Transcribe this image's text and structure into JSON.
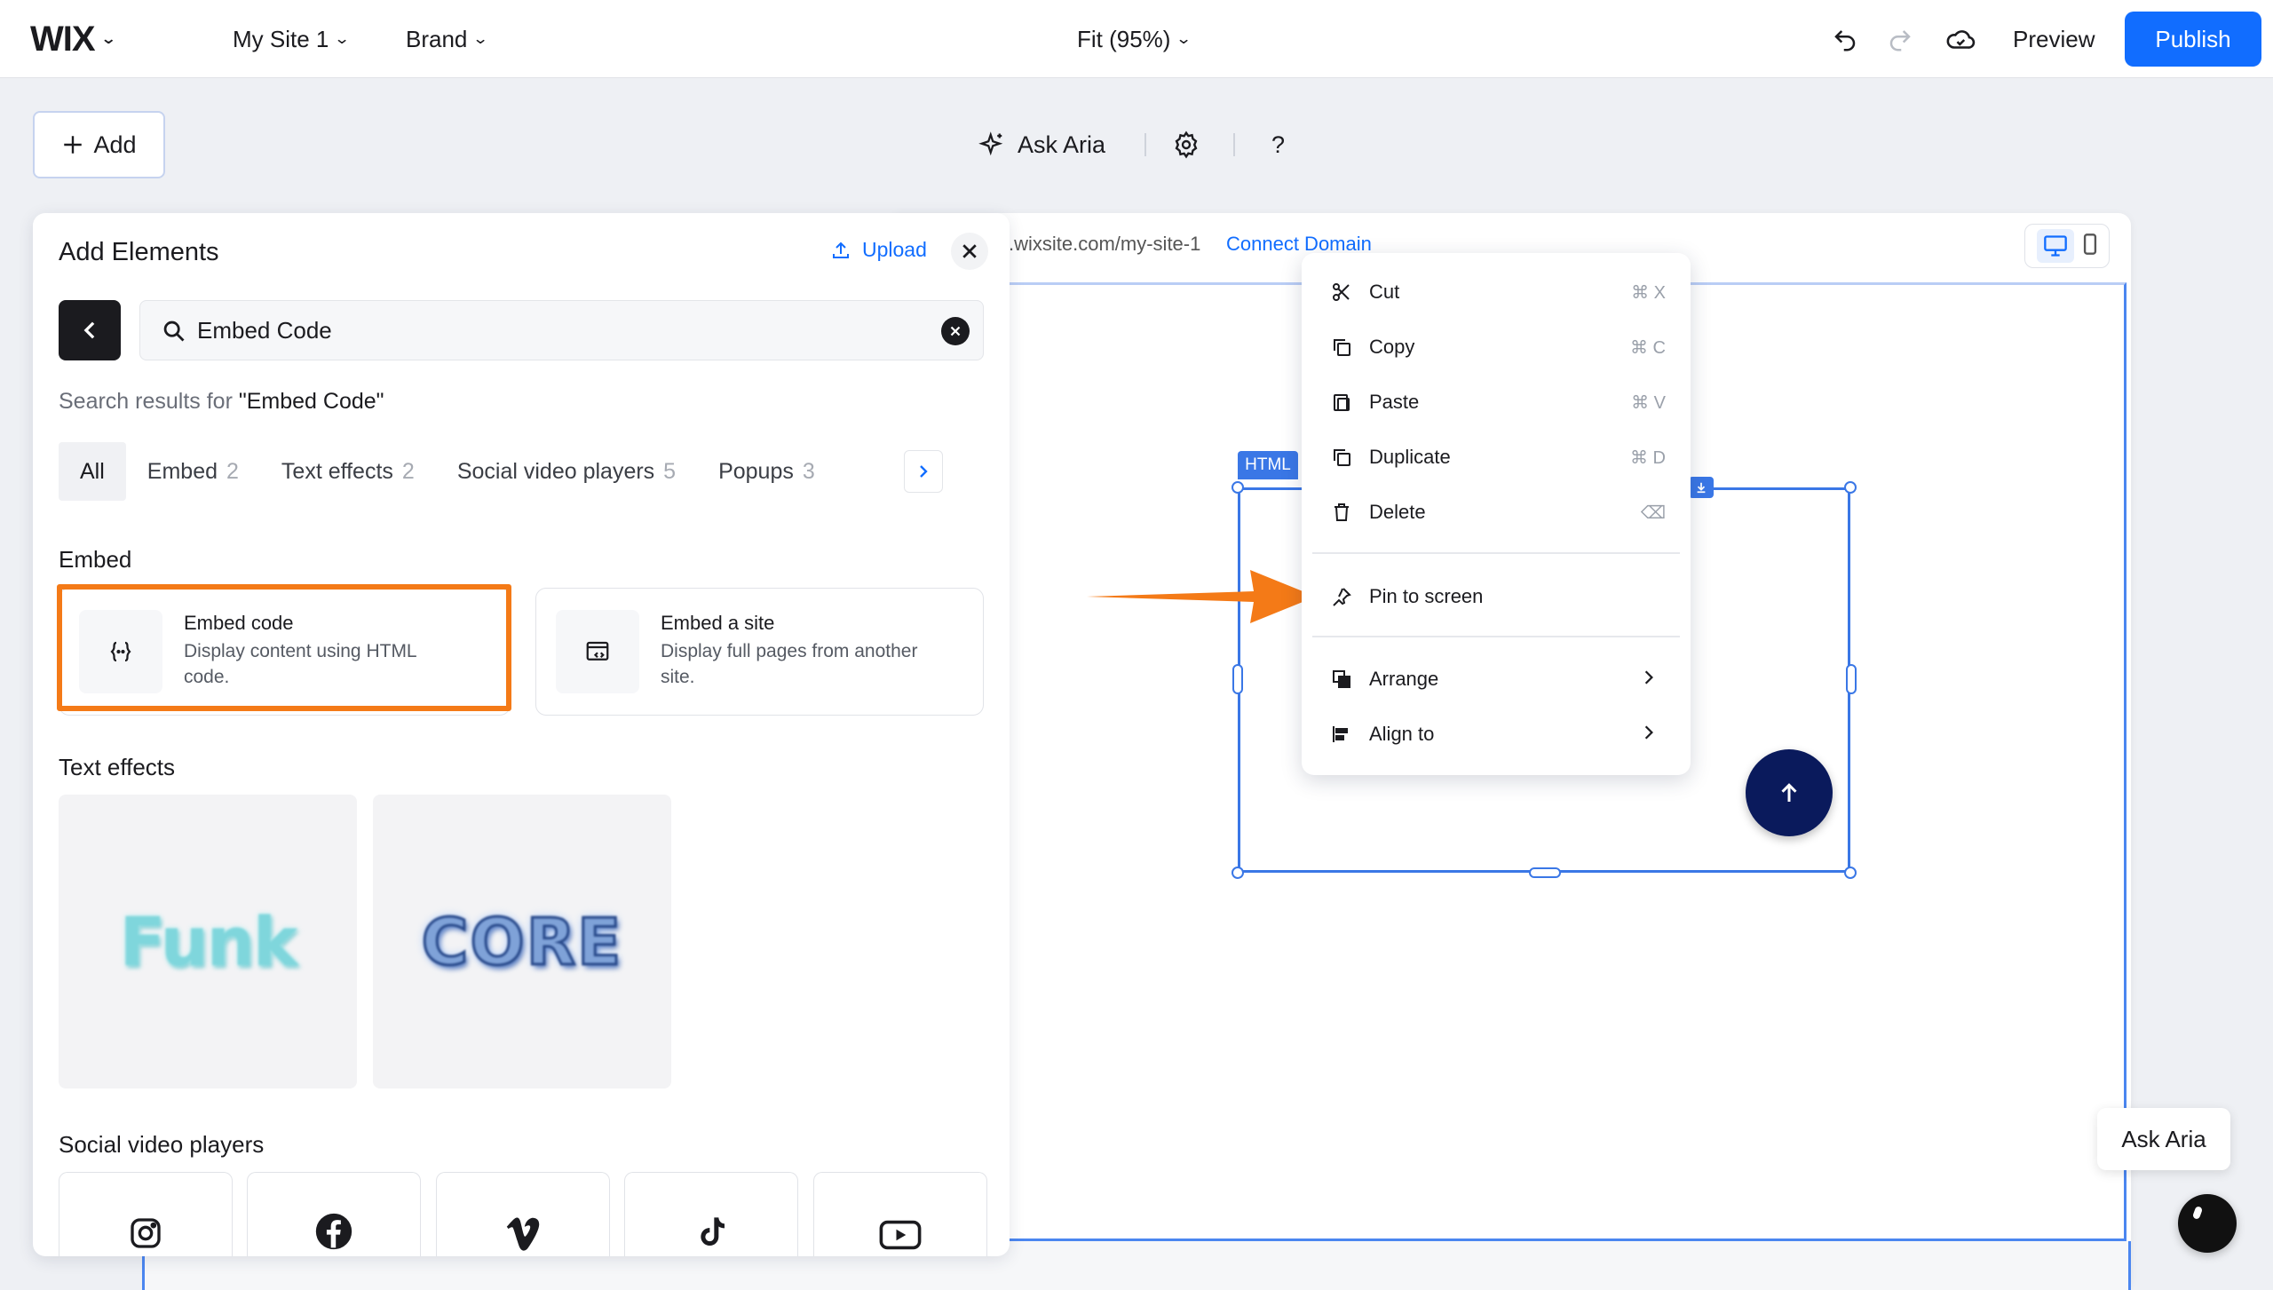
{
  "topbar": {
    "logo": "WIX",
    "site_menu": "My Site 1",
    "brand_menu": "Brand",
    "zoom": "Fit (95%)",
    "preview": "Preview",
    "publish": "Publish"
  },
  "toolbar": {
    "add_label": "Add",
    "ask_aria": "Ask Aria",
    "help": "?"
  },
  "stage": {
    "url": ".wixsite.com/my-site-1",
    "connect_domain": "Connect Domain",
    "html_tag": "HTML"
  },
  "context_menu": {
    "items": [
      {
        "label": "Cut",
        "shortcut": "⌘ X"
      },
      {
        "label": "Copy",
        "shortcut": "⌘ C"
      },
      {
        "label": "Paste",
        "shortcut": "⌘ V"
      },
      {
        "label": "Duplicate",
        "shortcut": "⌘ D"
      },
      {
        "label": "Delete",
        "shortcut": "⌫"
      },
      {
        "label": "Pin to screen",
        "shortcut": ""
      },
      {
        "label": "Arrange",
        "shortcut": ""
      },
      {
        "label": "Align to",
        "shortcut": ""
      }
    ]
  },
  "panel": {
    "title": "Add Elements",
    "upload": "Upload",
    "search_value": "Embed Code",
    "results_prefix": "Search results for ",
    "results_query": "\"Embed Code\"",
    "tabs": [
      {
        "label": "All",
        "count": ""
      },
      {
        "label": "Embed",
        "count": "2"
      },
      {
        "label": "Text effects",
        "count": "2"
      },
      {
        "label": "Social video players",
        "count": "5"
      },
      {
        "label": "Popups",
        "count": "3"
      }
    ],
    "sections": {
      "embed": "Embed",
      "text_effects": "Text effects",
      "social": "Social video players"
    },
    "embed_cards": [
      {
        "title": "Embed code",
        "desc": "Display content using HTML code."
      },
      {
        "title": "Embed a site",
        "desc": "Display full pages from another site."
      }
    ],
    "text_effects": [
      "Funk",
      "CORE"
    ],
    "social_icons": [
      "instagram-icon",
      "facebook-icon",
      "vimeo-icon",
      "tiktok-icon",
      "youtube-icon"
    ]
  },
  "aria_widget": {
    "label": "Ask Aria"
  },
  "colors": {
    "accent": "#116dff",
    "highlight": "#f47a17",
    "selection": "#3a77e6"
  }
}
